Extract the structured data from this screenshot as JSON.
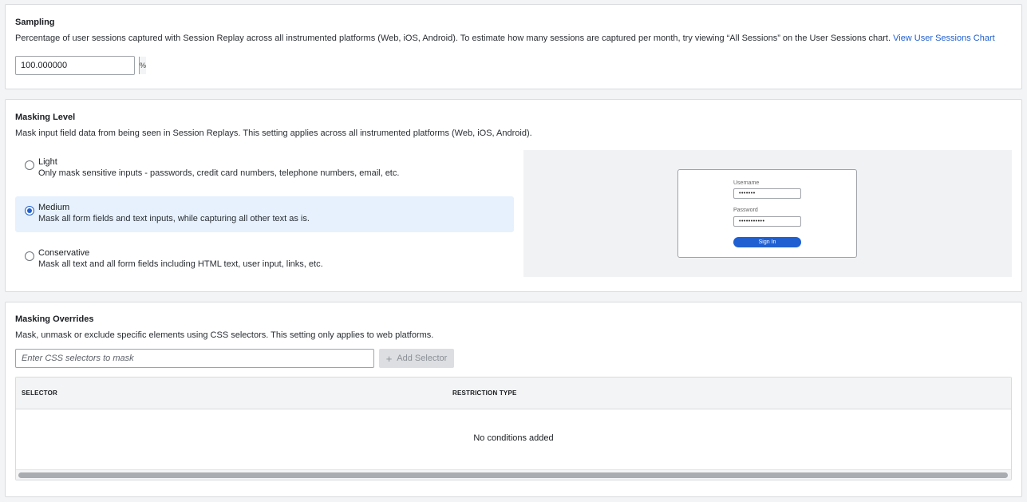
{
  "sampling": {
    "title": "Sampling",
    "description": "Percentage of user sessions captured with Session Replay across all instrumented platforms (Web, iOS, Android). To estimate how many sessions are captured per month, try viewing “All Sessions” on the User Sessions chart.",
    "link_label": "View User Sessions Chart",
    "value": "100.000000",
    "suffix": "%"
  },
  "masking_level": {
    "title": "Masking Level",
    "description": "Mask input field data from being seen in Session Replays. This setting applies across all instrumented platforms (Web, iOS, Android).",
    "selected": "Medium",
    "options": [
      {
        "label": "Light",
        "description": "Only mask sensitive inputs - passwords, credit card numbers, telephone numbers, email, etc."
      },
      {
        "label": "Medium",
        "description": "Mask all form fields and text inputs, while capturing all other text as is."
      },
      {
        "label": "Conservative",
        "description": "Mask all text and all form fields including HTML text, user input, links, etc."
      }
    ],
    "preview": {
      "username_label": "Username",
      "username_value": "•••••••",
      "password_label": "Password",
      "password_value": "•••••••••••",
      "button_label": "Sign In",
      "accent": "#1f5fd1"
    }
  },
  "overrides": {
    "title": "Masking Overrides",
    "description": "Mask, unmask or exclude specific elements using CSS selectors. This setting only applies to web platforms.",
    "input_placeholder": "Enter CSS selectors to mask",
    "input_value": "",
    "add_button_label": "Add Selector",
    "add_button_icon": "plus-icon",
    "columns": [
      "SELECTOR",
      "RESTRICTION TYPE"
    ],
    "rows": [],
    "empty_text": "No conditions added"
  }
}
